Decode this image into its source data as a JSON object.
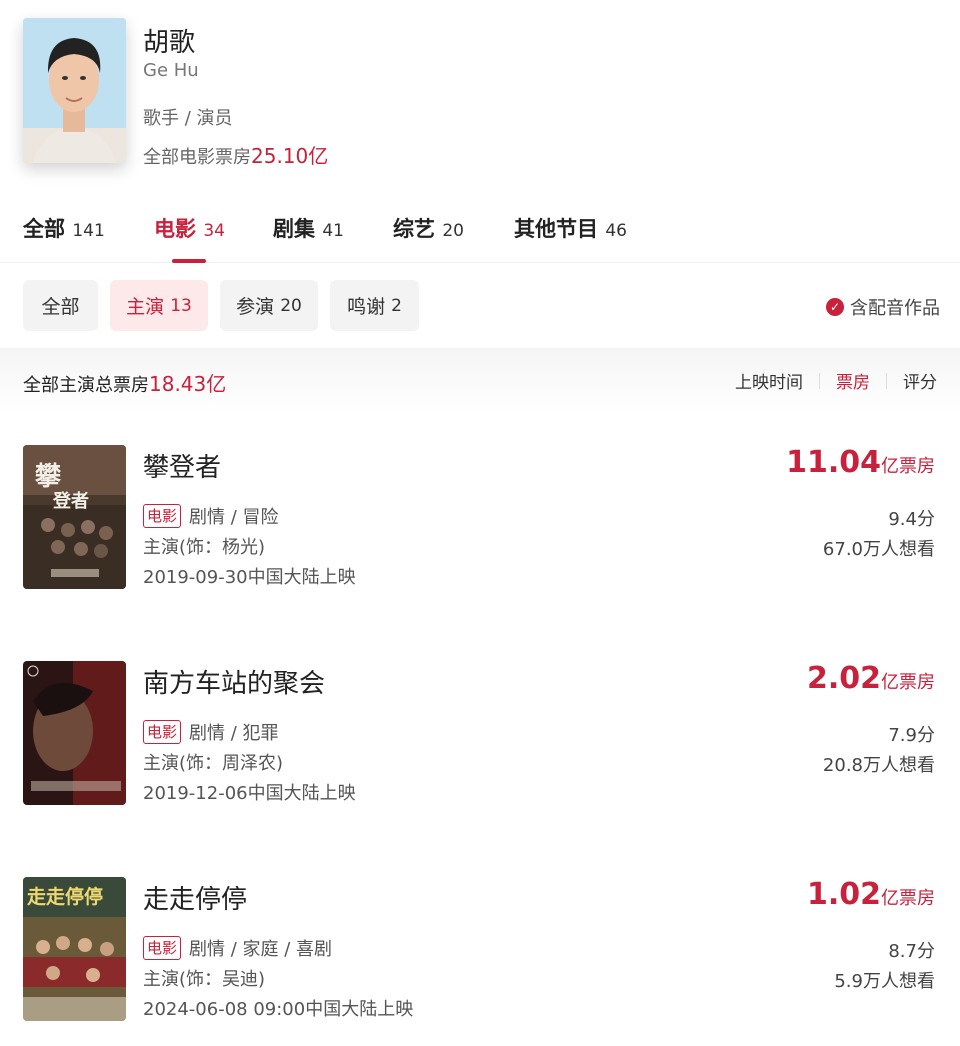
{
  "profile": {
    "name": "胡歌",
    "english_name": "Ge Hu",
    "roles": "歌手 / 演员",
    "box_office_label": "全部电影票房",
    "box_office_value": "25.10亿"
  },
  "tabs": [
    {
      "label": "全部",
      "count": "141",
      "active": false
    },
    {
      "label": "电影",
      "count": "34",
      "active": true
    },
    {
      "label": "剧集",
      "count": "41",
      "active": false
    },
    {
      "label": "综艺",
      "count": "20",
      "active": false
    },
    {
      "label": "其他节目",
      "count": "46",
      "active": false
    }
  ],
  "role_filters": [
    {
      "label": "全部",
      "count": ""
    },
    {
      "label": "主演",
      "count": "13"
    },
    {
      "label": "参演",
      "count": "20"
    },
    {
      "label": "鸣谢",
      "count": "2"
    }
  ],
  "dub_toggle": {
    "label": "含配音作品",
    "checked": true,
    "icon": "check-circle-icon"
  },
  "summary": {
    "label": "全部主演总票房",
    "value": "18.43亿"
  },
  "sort": {
    "release": "上映时间",
    "box_office": "票房",
    "rating": "评分"
  },
  "colors": {
    "accent": "#c8213b",
    "chip_active_bg": "#fde9ea",
    "chip_bg": "#f3f3f3"
  },
  "movies": [
    {
      "title": "攀登者",
      "badge": "电影",
      "genres": "剧情 / 冒险",
      "role": "主演(饰：杨光)",
      "release": "2019-09-30中国大陆上映",
      "box_number": "11.04",
      "box_unit": "亿票房",
      "score": "9.4分",
      "want": "67.0万人想看"
    },
    {
      "title": "南方车站的聚会",
      "badge": "电影",
      "genres": "剧情 / 犯罪",
      "role": "主演(饰：周泽农)",
      "release": "2019-12-06中国大陆上映",
      "box_number": "2.02",
      "box_unit": "亿票房",
      "score": "7.9分",
      "want": "20.8万人想看"
    },
    {
      "title": "走走停停",
      "badge": "电影",
      "genres": "剧情 / 家庭 / 喜剧",
      "role": "主演(饰：吴迪)",
      "release": "2024-06-08 09:00中国大陆上映",
      "box_number": "1.02",
      "box_unit": "亿票房",
      "score": "8.7分",
      "want": "5.9万人想看"
    }
  ]
}
